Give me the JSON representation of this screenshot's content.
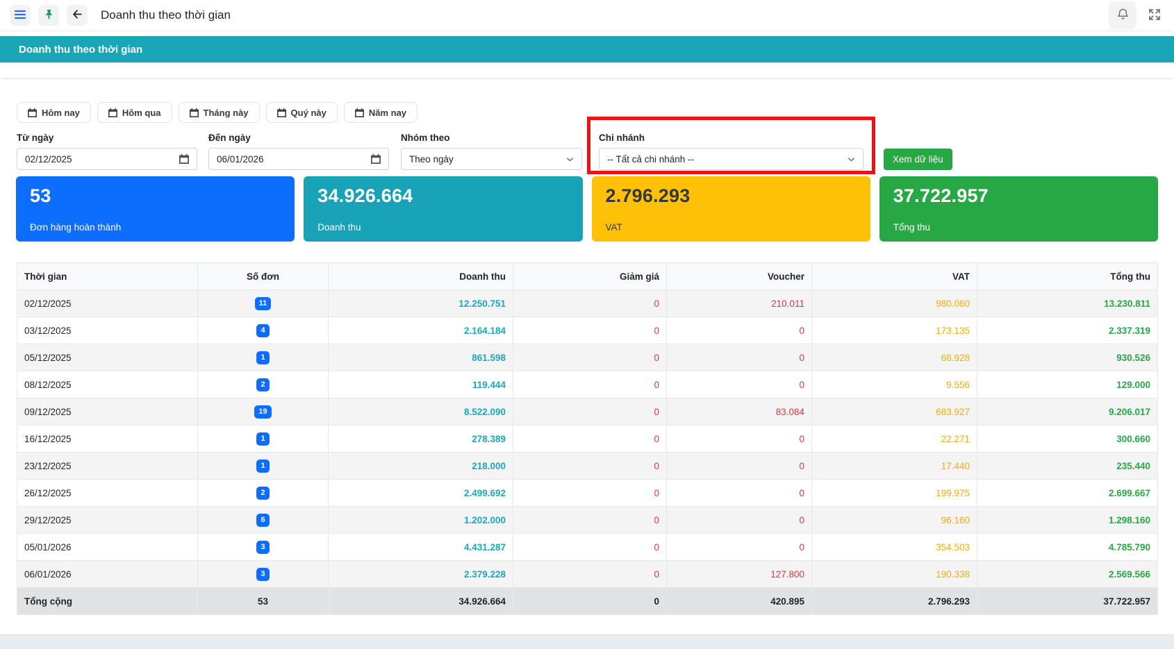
{
  "topbar": {
    "title": "Doanh thu theo thời gian",
    "icons": {
      "menu": "hamburger-menu-icon",
      "pin": "pushpin-icon",
      "back": "arrow-left-icon",
      "bell": "bell-icon",
      "fullscreen": "expand-arrows-icon"
    }
  },
  "banner": {
    "title": "Doanh thu theo thời gian"
  },
  "quick_filters": [
    {
      "label": "Hôm nay"
    },
    {
      "label": "Hôm qua"
    },
    {
      "label": "Tháng này"
    },
    {
      "label": "Quý này"
    },
    {
      "label": "Năm nay"
    }
  ],
  "filters": {
    "from_date": {
      "label": "Từ ngày",
      "value": "02/12/2025"
    },
    "to_date": {
      "label": "Đến ngày",
      "value": "06/01/2026"
    },
    "group_by": {
      "label": "Nhóm theo",
      "value": "Theo ngày"
    },
    "branch": {
      "label": "Chi nhánh",
      "value": "-- Tất cả chi nhánh --",
      "highlighted": true
    },
    "submit_label": "Xem dữ liệu"
  },
  "stat_cards": [
    {
      "value": "53",
      "label": "Đơn hàng hoàn thành",
      "bg": "#0d6efd",
      "fg": "#ffffff"
    },
    {
      "value": "34.926.664",
      "label": "Doanh thu",
      "bg": "#17a2b8",
      "fg": "#ffffff"
    },
    {
      "value": "2.796.293",
      "label": "VAT",
      "bg": "#ffc107",
      "fg": "#32383e"
    },
    {
      "value": "37.722.957",
      "label": "Tổng thu",
      "bg": "#28a745",
      "fg": "#ffffff"
    }
  ],
  "table": {
    "columns": [
      "Thời gian",
      "Số đơn",
      "Doanh thu",
      "Giảm giá",
      "Voucher",
      "VAT",
      "Tổng thu"
    ],
    "rows": [
      {
        "date": "02/12/2025",
        "orders": "11",
        "revenue": "12.250.751",
        "discount": "0",
        "voucher": "210.011",
        "vat": "980.060",
        "total": "13.230.811"
      },
      {
        "date": "03/12/2025",
        "orders": "4",
        "revenue": "2.164.184",
        "discount": "0",
        "voucher": "0",
        "vat": "173.135",
        "total": "2.337.319"
      },
      {
        "date": "05/12/2025",
        "orders": "1",
        "revenue": "861.598",
        "discount": "0",
        "voucher": "0",
        "vat": "68.928",
        "total": "930.526"
      },
      {
        "date": "08/12/2025",
        "orders": "2",
        "revenue": "119.444",
        "discount": "0",
        "voucher": "0",
        "vat": "9.556",
        "total": "129.000"
      },
      {
        "date": "09/12/2025",
        "orders": "19",
        "revenue": "8.522.090",
        "discount": "0",
        "voucher": "83.084",
        "vat": "683.927",
        "total": "9.206.017"
      },
      {
        "date": "16/12/2025",
        "orders": "1",
        "revenue": "278.389",
        "discount": "0",
        "voucher": "0",
        "vat": "22.271",
        "total": "300.660"
      },
      {
        "date": "23/12/2025",
        "orders": "1",
        "revenue": "218.000",
        "discount": "0",
        "voucher": "0",
        "vat": "17.440",
        "total": "235.440"
      },
      {
        "date": "26/12/2025",
        "orders": "2",
        "revenue": "2.499.692",
        "discount": "0",
        "voucher": "0",
        "vat": "199.975",
        "total": "2.699.667"
      },
      {
        "date": "29/12/2025",
        "orders": "6",
        "revenue": "1.202.000",
        "discount": "0",
        "voucher": "0",
        "vat": "96.160",
        "total": "1.298.160"
      },
      {
        "date": "05/01/2026",
        "orders": "3",
        "revenue": "4.431.287",
        "discount": "0",
        "voucher": "0",
        "vat": "354.503",
        "total": "4.785.790"
      },
      {
        "date": "06/01/2026",
        "orders": "3",
        "revenue": "2.379.228",
        "discount": "0",
        "voucher": "127.800",
        "vat": "190.338",
        "total": "2.569.566"
      }
    ],
    "footer": {
      "label": "Tổng cộng",
      "orders": "53",
      "revenue": "34.926.664",
      "discount": "0",
      "voucher": "420.895",
      "vat": "2.796.293",
      "total": "37.722.957"
    }
  },
  "colors": {
    "banner": "#1aa6b6",
    "highlight_box": "#ee1212",
    "badge": "#0d6efd",
    "revenue_text": "#1da7bd",
    "discount_text": "#dc3545",
    "voucher_text": "#dc3545",
    "vat_text": "#efae08",
    "total_text": "#28a745",
    "submit_button": "#28a745"
  }
}
